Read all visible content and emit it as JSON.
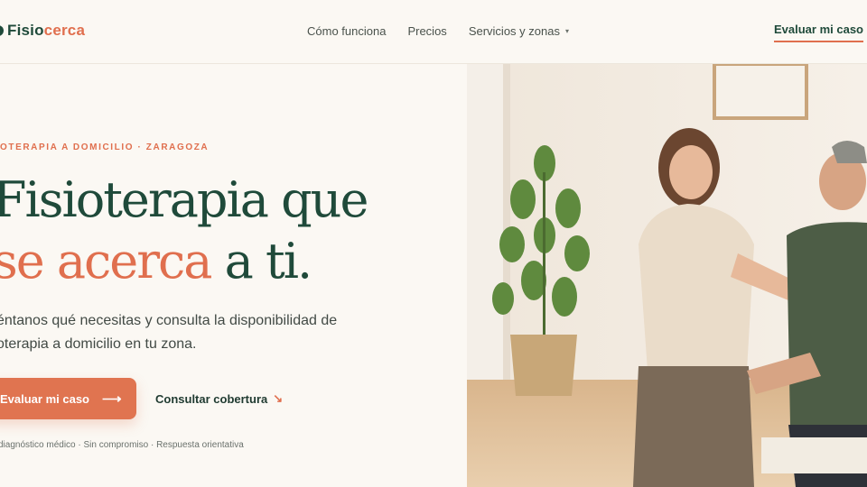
{
  "brand": {
    "name_part1": "Fisio",
    "name_part2": "cerca",
    "mark_icon": "leaf-logo-icon"
  },
  "nav": {
    "items": [
      {
        "label": "Cómo funciona"
      },
      {
        "label": "Precios"
      },
      {
        "label": "Servicios y zonas",
        "has_dropdown": true
      }
    ],
    "caret_glyph": "▾",
    "cta_label": "Evaluar mi caso"
  },
  "hero": {
    "eyebrow": "OTERAPIA A DOMICILIO · ZARAGOZA",
    "headline_line1": "Fisioterapia que",
    "headline_accent": "se acerca",
    "headline_rest": " a ti.",
    "lead_line1": "éntanos qué necesitas y consulta la disponibilidad de",
    "lead_line2": "oterapia a domicilio en tu zona.",
    "primary_cta": "Evaluar mi caso",
    "primary_cta_arrow": "⟶",
    "secondary_cta": "Consultar cobertura",
    "secondary_cta_arrow": "↘",
    "trust_line": "diagnóstico médico · Sin compromiso · Respuesta orientativa"
  },
  "image": {
    "description_icon": "photo-physio-home-visit"
  },
  "colors": {
    "primary": "#1f4a3a",
    "accent": "#e06f4e",
    "background": "#fbf8f3"
  }
}
